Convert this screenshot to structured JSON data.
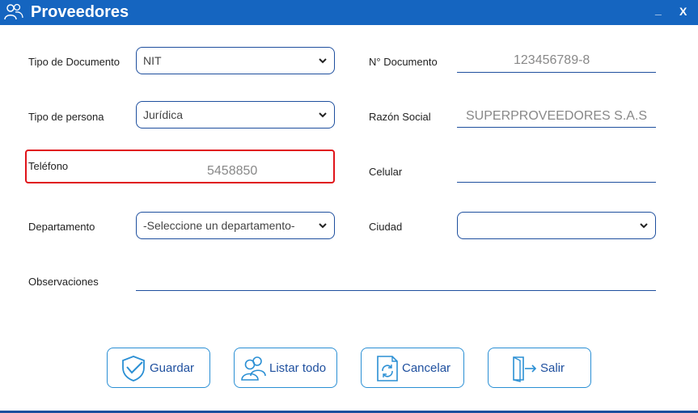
{
  "window": {
    "title": "Proveedores",
    "minimize_label": "_",
    "close_label": "X"
  },
  "form": {
    "tipo_documento": {
      "label": "Tipo de Documento",
      "value": "NIT"
    },
    "num_documento": {
      "label": "N° Documento",
      "value": "123456789-8"
    },
    "tipo_persona": {
      "label": "Tipo de persona",
      "value": "Jurídica"
    },
    "razon_social": {
      "label": "Razón Social",
      "value": "SUPERPROVEEDORES S.A.S"
    },
    "telefono": {
      "label": "Teléfono",
      "value": "5458850"
    },
    "celular": {
      "label": "Celular",
      "value": ""
    },
    "departamento": {
      "label": "Departamento",
      "value": "-Seleccione un departamento-"
    },
    "ciudad": {
      "label": "Ciudad",
      "value": ""
    },
    "observaciones": {
      "label": "Observaciones",
      "value": ""
    }
  },
  "buttons": {
    "guardar": {
      "label": "Guardar",
      "icon": "shield-check-icon"
    },
    "listar": {
      "label": "Listar todo",
      "icon": "users-icon"
    },
    "cancelar": {
      "label": "Cancelar",
      "icon": "refresh-document-icon"
    },
    "salir": {
      "label": "Salir",
      "icon": "exit-door-icon"
    }
  },
  "colors": {
    "titlebar": "#1565c0",
    "border": "#1e4f9e",
    "button_border": "#2a8fd4",
    "highlight": "#e0141a"
  }
}
